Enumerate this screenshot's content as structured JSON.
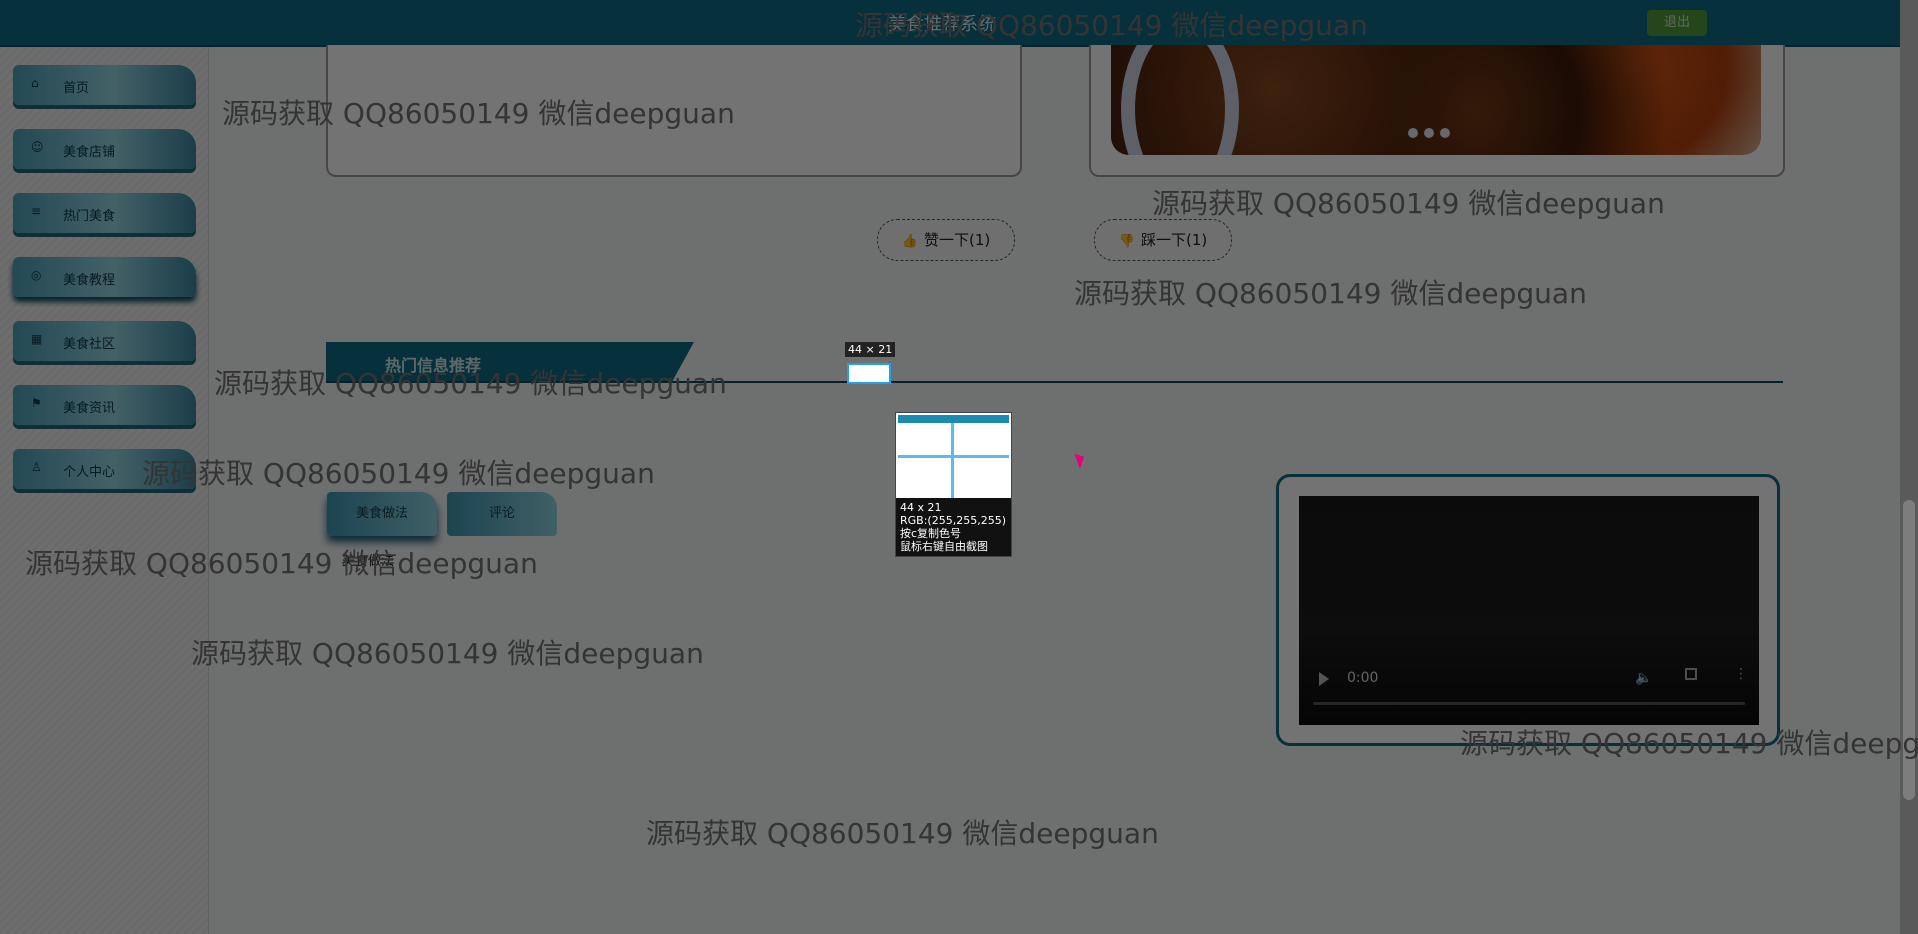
{
  "app": {
    "title": "美食推荐系统",
    "logout_label": "退出"
  },
  "sidebar": {
    "items": [
      {
        "icon": "home-icon",
        "label": "首页"
      },
      {
        "icon": "shop-icon",
        "label": "美食店铺"
      },
      {
        "icon": "fire-icon",
        "label": "热门美食"
      },
      {
        "icon": "book-icon",
        "label": "美食教程"
      },
      {
        "icon": "community-icon",
        "label": "美食社区"
      },
      {
        "icon": "flag-icon",
        "label": "美食资讯"
      },
      {
        "icon": "user-icon",
        "label": "个人中心"
      }
    ]
  },
  "content": {
    "carousel_dots": 3,
    "like_button": "赞一下(1)",
    "dislike_button": "踩一下(1)",
    "section_title": "热门信息推荐",
    "tabs": [
      "美食做法",
      "评论"
    ],
    "tab_text": "美食做法"
  },
  "video": {
    "time": "0:00"
  },
  "screenshot_tool": {
    "size_label": "44 × 21",
    "info": [
      "44 x 21",
      "RGB:(255,255,255)",
      "按c复制色号",
      "鼠标右键自由截图"
    ]
  },
  "watermark": "源码获取 QQ86050149 微信deepguan",
  "colors": {
    "primary": "#0f6a84",
    "accent_light": "#98d6e5",
    "logout": "#4f9e3c"
  }
}
